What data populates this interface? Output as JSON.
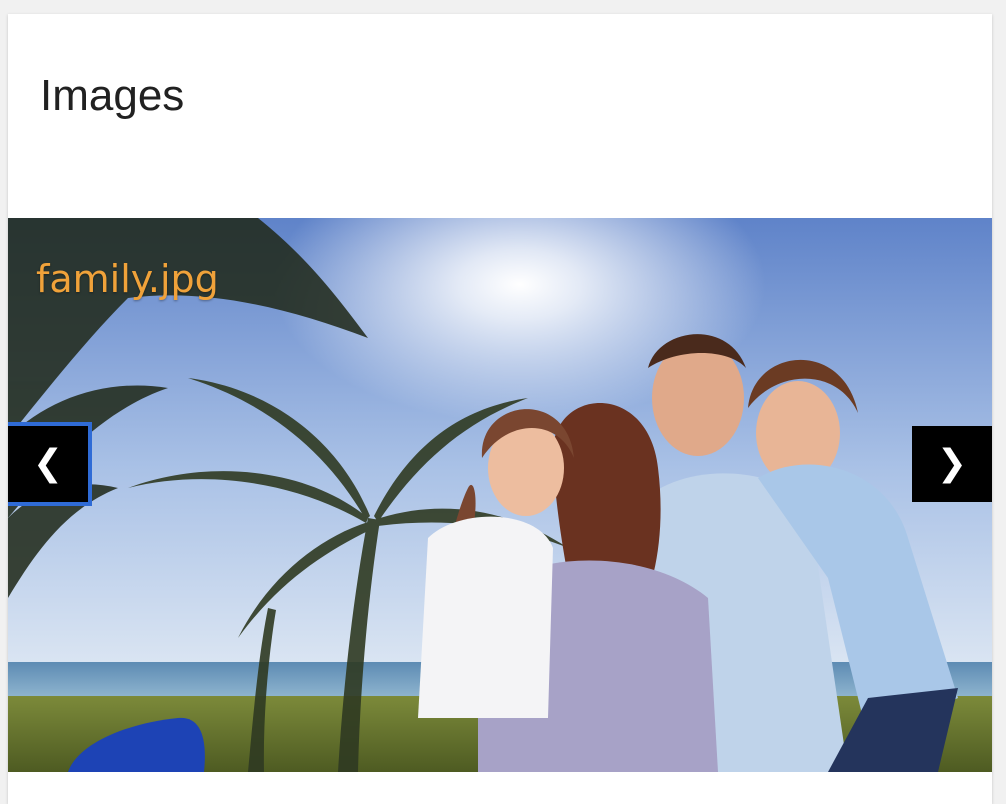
{
  "card": {
    "title": "Images"
  },
  "carousel": {
    "current_slide": {
      "filename": "family.jpg",
      "image_description_icon": "family-photo"
    },
    "prev_icon": "chevron-left-icon",
    "next_icon": "chevron-right-icon",
    "prev_glyph": "❮",
    "next_glyph": "❯"
  },
  "colors": {
    "caption": "#f0a23a",
    "nav_background": "#000000",
    "focus_ring": "#2f6bd6"
  }
}
